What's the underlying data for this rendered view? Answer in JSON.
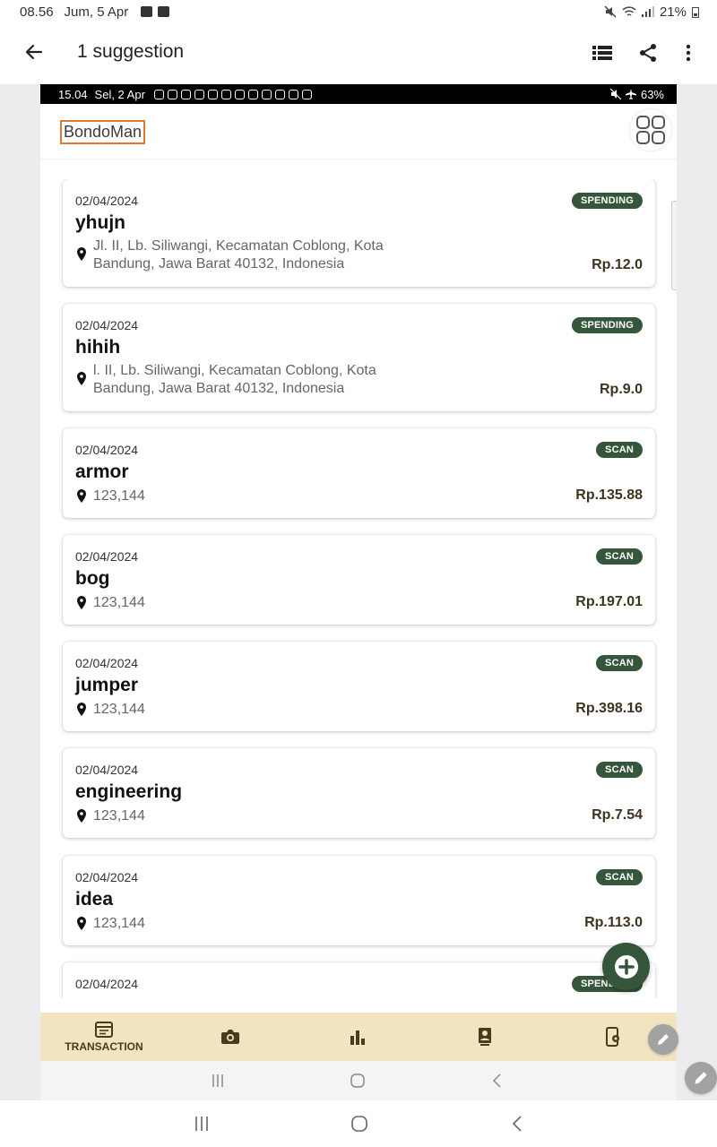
{
  "outer_status": {
    "time": "08.56",
    "date": "Jum, 5 Apr",
    "battery": "21%"
  },
  "outer_appbar": {
    "title": "1 suggestion"
  },
  "inner_status": {
    "time": "15.04",
    "date": "Sel, 2 Apr",
    "battery": "63%"
  },
  "app": {
    "brand": "BondoMan"
  },
  "transactions": [
    {
      "date": "02/04/2024",
      "name": "yhujn",
      "type": "SPENDING",
      "location_line1": "Jl. II, Lb. Siliwangi, Kecamatan Coblong, Kota",
      "location_line2": "Bandung, Jawa Barat 40132, Indonesia",
      "amount": "Rp.12.0"
    },
    {
      "date": "02/04/2024",
      "name": "hihih",
      "type": "SPENDING",
      "location_line1": "l. II, Lb. Siliwangi, Kecamatan Coblong, Kota",
      "location_line2": "Bandung, Jawa Barat 40132, Indonesia",
      "amount": "Rp.9.0"
    },
    {
      "date": "02/04/2024",
      "name": "armor",
      "type": "SCAN",
      "location_line1": "123,144",
      "amount": "Rp.135.88"
    },
    {
      "date": "02/04/2024",
      "name": "bog",
      "type": "SCAN",
      "location_line1": "123,144",
      "amount": "Rp.197.01"
    },
    {
      "date": "02/04/2024",
      "name": "jumper",
      "type": "SCAN",
      "location_line1": "123,144",
      "amount": "Rp.398.16"
    },
    {
      "date": "02/04/2024",
      "name": "engineering",
      "type": "SCAN",
      "location_line1": "123,144",
      "amount": "Rp.7.54"
    },
    {
      "date": "02/04/2024",
      "name": "idea",
      "type": "SCAN",
      "location_line1": "123,144",
      "amount": "Rp.113.0"
    },
    {
      "date": "02/04/2024",
      "type": "SPENDING"
    }
  ],
  "bottom_nav": {
    "transaction_label": "TRANSACTION"
  },
  "colors": {
    "accent": "#35563a",
    "nav_bg": "#f2e4c0",
    "brand_border": "#e07a2c"
  }
}
